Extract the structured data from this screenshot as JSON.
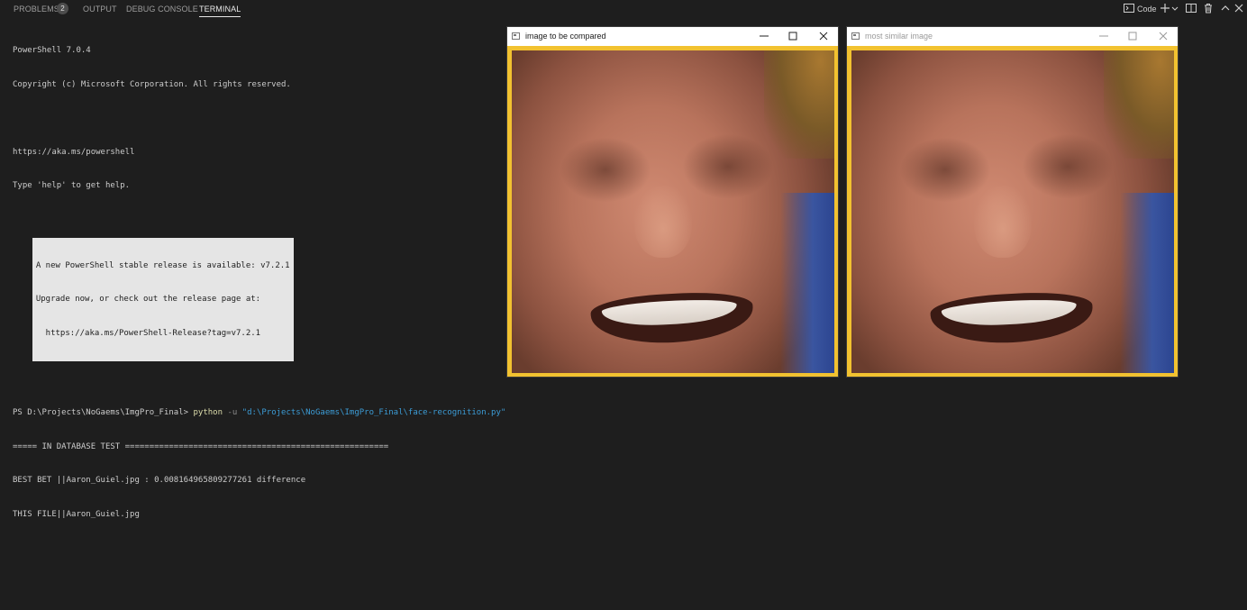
{
  "panel": {
    "tabs": [
      {
        "label": "PROBLEMS",
        "badge": "2"
      },
      {
        "label": "OUTPUT"
      },
      {
        "label": "DEBUG CONSOLE"
      },
      {
        "label": "TERMINAL",
        "active": true
      }
    ],
    "toolbar": {
      "terminal_label": "Code",
      "icons": [
        "terminal-icon",
        "plus-icon",
        "chevron-down-icon",
        "split-icon",
        "trash-icon",
        "chevron-up-icon",
        "close-icon"
      ]
    }
  },
  "terminal": {
    "header_lines": [
      "PowerShell 7.0.4",
      "Copyright (c) Microsoft Corporation. All rights reserved.",
      "",
      "https://aka.ms/powershell",
      "Type 'help' to get help."
    ],
    "notice_lines": [
      "A new PowerShell stable release is available: v7.2.1",
      "Upgrade now, or check out the release page at:",
      "  https://aka.ms/PowerShell-Release?tag=v7.2.1"
    ],
    "prompt": "PS D:\\Projects\\NoGaems\\ImgPro_Final>",
    "command": "python",
    "flag": "-u",
    "argument": "\"d:\\Projects\\NoGaems\\ImgPro_Final\\face-recognition.py\"",
    "output_lines": [
      "===== IN DATABASE TEST ======================================================",
      "BEST BET ||Aaron_Guiel.jpg : 0.008164965809277261 difference",
      "THIS FILE||Aaron_Guiel.jpg"
    ]
  },
  "windows": [
    {
      "title": "image to be compared",
      "state": "active"
    },
    {
      "title": "most similar image",
      "state": "inactive"
    }
  ],
  "colors": {
    "background": "#1e1e1e",
    "terminal_text": "#cccccc",
    "command": "#dcdcaa",
    "string": "#3c9cd6",
    "image_border": "#f2c230"
  }
}
